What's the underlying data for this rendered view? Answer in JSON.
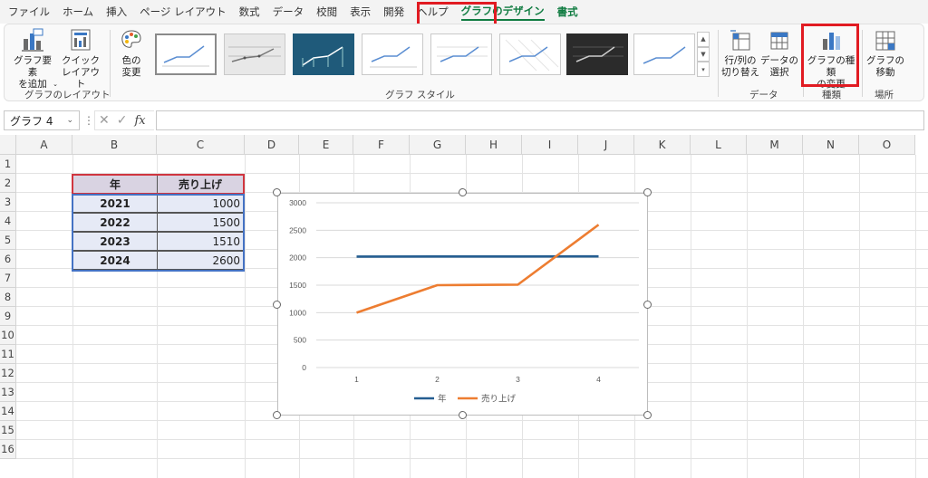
{
  "menu": {
    "tabs": [
      "ファイル",
      "ホーム",
      "挿入",
      "ページ レイアウト",
      "数式",
      "データ",
      "校閲",
      "表示",
      "開発",
      "ヘルプ"
    ],
    "active_tab": "グラフのデザイン",
    "format_tab": "書式"
  },
  "ribbon": {
    "add_element_l1": "グラフ要素",
    "add_element_l2": "を追加",
    "quick_layout_l1": "クイック",
    "quick_layout_l2": "レイアウト",
    "colors_l1": "色の",
    "colors_l2": "変更",
    "group_layout": "グラフのレイアウト",
    "group_styles": "グラフ スタイル",
    "switch_l1": "行/列の",
    "switch_l2": "切り替え",
    "select_data_l1": "データの",
    "select_data_l2": "選択",
    "group_data": "データ",
    "change_type_l1": "グラフの種類",
    "change_type_l2": "の変更",
    "group_type": "種類",
    "move_chart_l1": "グラフの",
    "move_chart_l2": "移動",
    "group_location": "場所"
  },
  "formula_bar": {
    "name_box": "グラフ 4",
    "fx_label": "fx",
    "formula": ""
  },
  "columns": [
    "A",
    "B",
    "C",
    "D",
    "E",
    "F",
    "G",
    "H",
    "I",
    "J",
    "K",
    "L",
    "M",
    "N",
    "O"
  ],
  "rows": [
    "1",
    "2",
    "3",
    "4",
    "5",
    "6",
    "7",
    "8",
    "9",
    "10",
    "11",
    "12",
    "13",
    "14",
    "15",
    "16"
  ],
  "table": {
    "headers": [
      "年",
      "売り上げ"
    ],
    "rows": [
      [
        "2021",
        "1000"
      ],
      [
        "2022",
        "1500"
      ],
      [
        "2023",
        "1510"
      ],
      [
        "2024",
        "2600"
      ]
    ]
  },
  "colors": {
    "accent_green": "#107c41",
    "highlight_red": "#e11b22",
    "series_year": "#255e91",
    "series_sales": "#ed7d31"
  },
  "chart_data": {
    "type": "line",
    "categories": [
      "1",
      "2",
      "3",
      "4"
    ],
    "series": [
      {
        "name": "年",
        "values": [
          2021,
          2022,
          2023,
          2024
        ],
        "color": "#255e91"
      },
      {
        "name": "売り上げ",
        "values": [
          1000,
          1500,
          1510,
          2600
        ],
        "color": "#ed7d31"
      }
    ],
    "title": "",
    "xlabel": "",
    "ylabel": "",
    "ylim": [
      0,
      3000
    ],
    "yticks": [
      0,
      500,
      1000,
      1500,
      2000,
      2500,
      3000
    ],
    "grid": true,
    "legend": "bottom"
  }
}
